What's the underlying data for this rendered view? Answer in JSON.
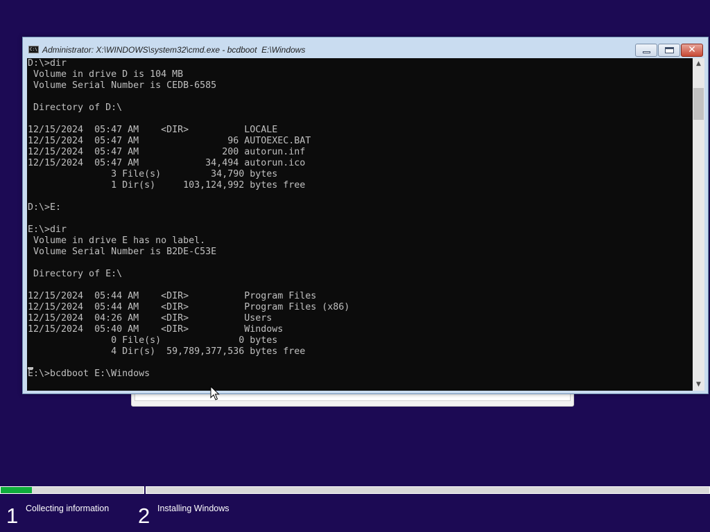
{
  "window": {
    "title": "Administrator: X:\\WINDOWS\\system32\\cmd.exe - bcdboot  E:\\Windows",
    "icon_label": "C:\\",
    "close_glyph": "✕"
  },
  "console": {
    "text": "D:\\>dir\n Volume in drive D is 104 MB\n Volume Serial Number is CEDB-6585\n\n Directory of D:\\\n\n12/15/2024  05:47 AM    <DIR>          LOCALE\n12/15/2024  05:47 AM                96 AUTOEXEC.BAT\n12/15/2024  05:47 AM               200 autorun.inf\n12/15/2024  05:47 AM            34,494 autorun.ico\n               3 File(s)         34,790 bytes\n               1 Dir(s)     103,124,992 bytes free\n\nD:\\>E:\n\nE:\\>dir\n Volume in drive E has no label.\n Volume Serial Number is B2DE-C53E\n\n Directory of E:\\\n\n12/15/2024  05:44 AM    <DIR>          Program Files\n12/15/2024  05:44 AM    <DIR>          Program Files (x86)\n12/15/2024  04:26 AM    <DIR>          Users\n12/15/2024  05:40 AM    <DIR>          Windows\n               0 File(s)              0 bytes\n               4 Dir(s)  59,789,377,536 bytes free\n\nE:\\>bcdboot E:\\Windows"
  },
  "scrollbar": {
    "up_glyph": "▲",
    "down_glyph": "▼"
  },
  "setup": {
    "steps": [
      {
        "number": "1",
        "label": "Collecting information",
        "progress": 0.22
      },
      {
        "number": "2",
        "label": "Installing Windows",
        "progress": 0
      }
    ]
  },
  "colors": {
    "desktop": "#1c0a54",
    "progress_fill": "#0fad3c",
    "console_bg": "#0c0c0c",
    "console_fg": "#c0c0c0"
  }
}
